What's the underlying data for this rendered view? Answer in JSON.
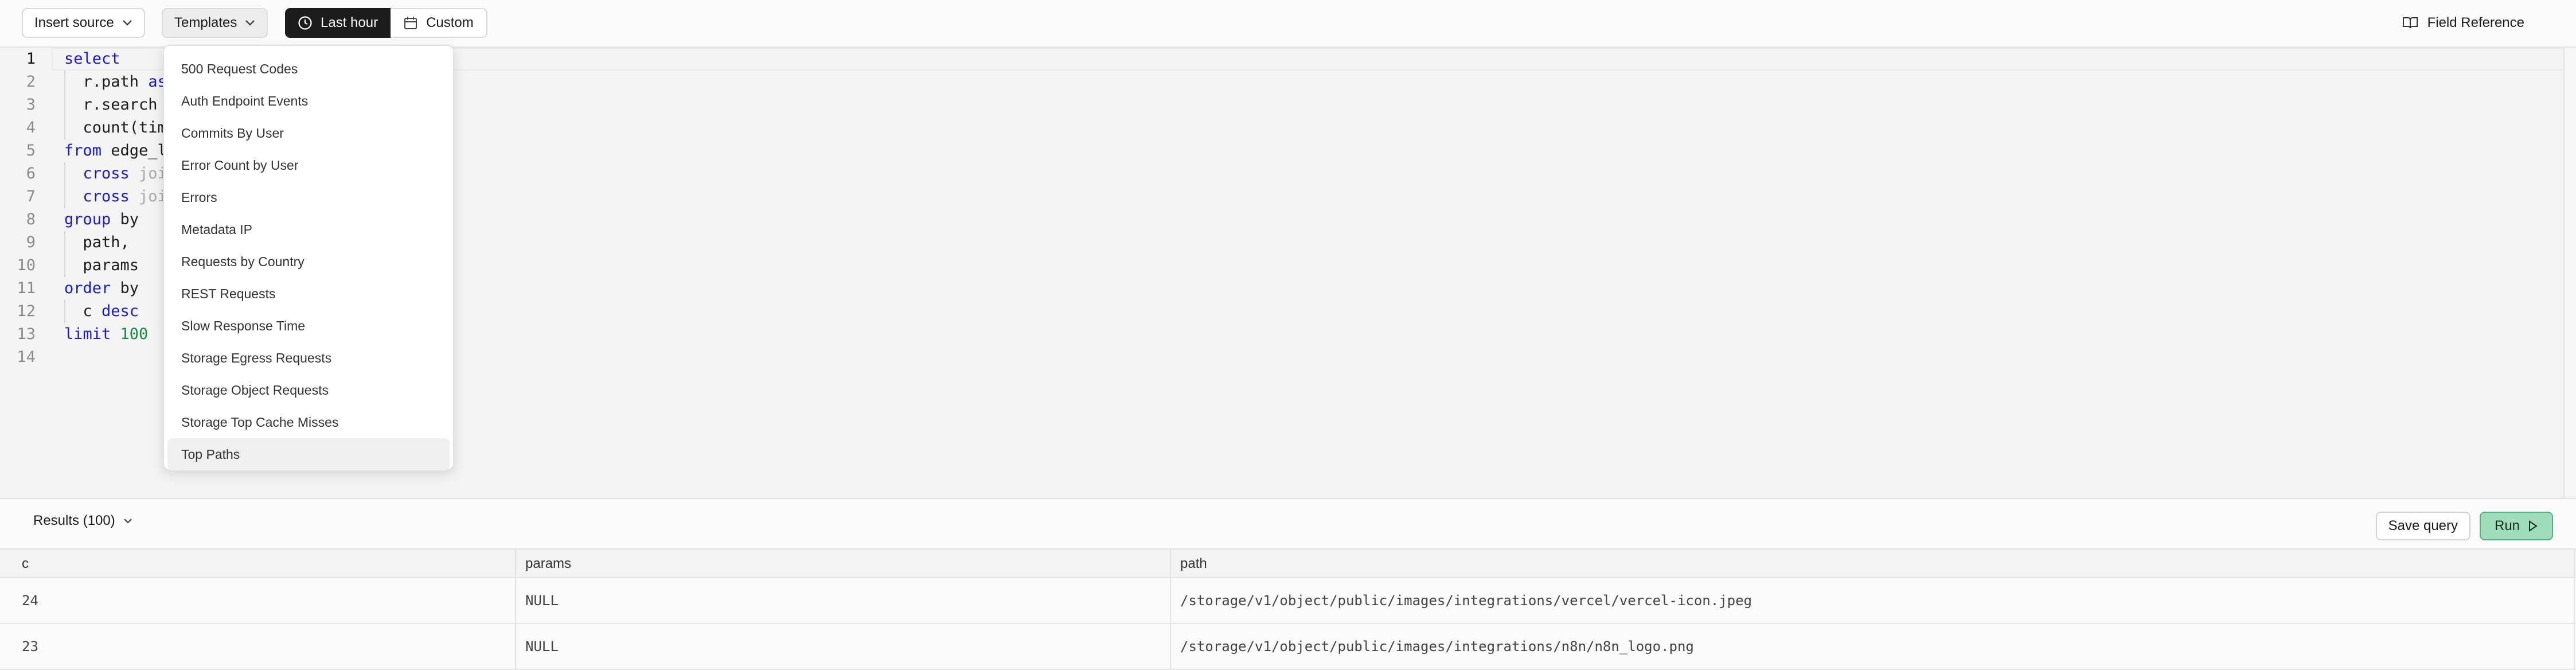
{
  "toolbar": {
    "insert_source": "Insert source",
    "templates": "Templates",
    "last_hour": "Last hour",
    "custom": "Custom",
    "field_reference": "Field Reference"
  },
  "editor": {
    "lines": [
      {
        "n": "1",
        "parts": [
          {
            "t": "select",
            "c": "kw"
          }
        ]
      },
      {
        "n": "2",
        "parts": [
          {
            "t": "  r.path ",
            "c": ""
          },
          {
            "t": "as",
            "c": "kw"
          }
        ]
      },
      {
        "n": "3",
        "parts": [
          {
            "t": "  r.search",
            "c": ""
          }
        ]
      },
      {
        "n": "4",
        "parts": [
          {
            "t": "  count(tim",
            "c": ""
          }
        ]
      },
      {
        "n": "5",
        "parts": [
          {
            "t": "from",
            "c": "kw"
          },
          {
            "t": " edge_l",
            "c": ""
          }
        ]
      },
      {
        "n": "6",
        "parts": [
          {
            "t": "  ",
            "c": ""
          },
          {
            "t": "cross",
            "c": "kw"
          },
          {
            "t": " joi",
            "c": "dim"
          }
        ]
      },
      {
        "n": "7",
        "parts": [
          {
            "t": "  ",
            "c": ""
          },
          {
            "t": "cross",
            "c": "kw"
          },
          {
            "t": " joi",
            "c": "dim"
          }
        ]
      },
      {
        "n": "8",
        "parts": [
          {
            "t": "group",
            "c": "kw"
          },
          {
            "t": " by",
            "c": ""
          }
        ]
      },
      {
        "n": "9",
        "parts": [
          {
            "t": "  path,",
            "c": ""
          }
        ]
      },
      {
        "n": "10",
        "parts": [
          {
            "t": "  params",
            "c": ""
          }
        ]
      },
      {
        "n": "11",
        "parts": [
          {
            "t": "order",
            "c": "kw"
          },
          {
            "t": " by",
            "c": ""
          }
        ]
      },
      {
        "n": "12",
        "parts": [
          {
            "t": "  c ",
            "c": ""
          },
          {
            "t": "desc",
            "c": "kw"
          }
        ]
      },
      {
        "n": "13",
        "parts": [
          {
            "t": "limit",
            "c": "kw"
          },
          {
            "t": " ",
            "c": ""
          },
          {
            "t": "100",
            "c": "num"
          }
        ]
      },
      {
        "n": "14",
        "parts": []
      }
    ]
  },
  "templates_menu": {
    "items": [
      "500 Request Codes",
      "Auth Endpoint Events",
      "Commits By User",
      "Error Count by User",
      "Errors",
      "Metadata IP",
      "Requests by Country",
      "REST Requests",
      "Slow Response Time",
      "Storage Egress Requests",
      "Storage Object Requests",
      "Storage Top Cache Misses",
      "Top Paths"
    ],
    "selected": "Top Paths"
  },
  "results": {
    "label": "Results (100)",
    "save_query": "Save query",
    "run": "Run",
    "columns": [
      "c",
      "params",
      "path"
    ],
    "rows": [
      [
        "24",
        "NULL",
        "/storage/v1/object/public/images/integrations/vercel/vercel-icon.jpeg"
      ],
      [
        "23",
        "NULL",
        "/storage/v1/object/public/images/integrations/n8n/n8n_logo.png"
      ]
    ]
  }
}
